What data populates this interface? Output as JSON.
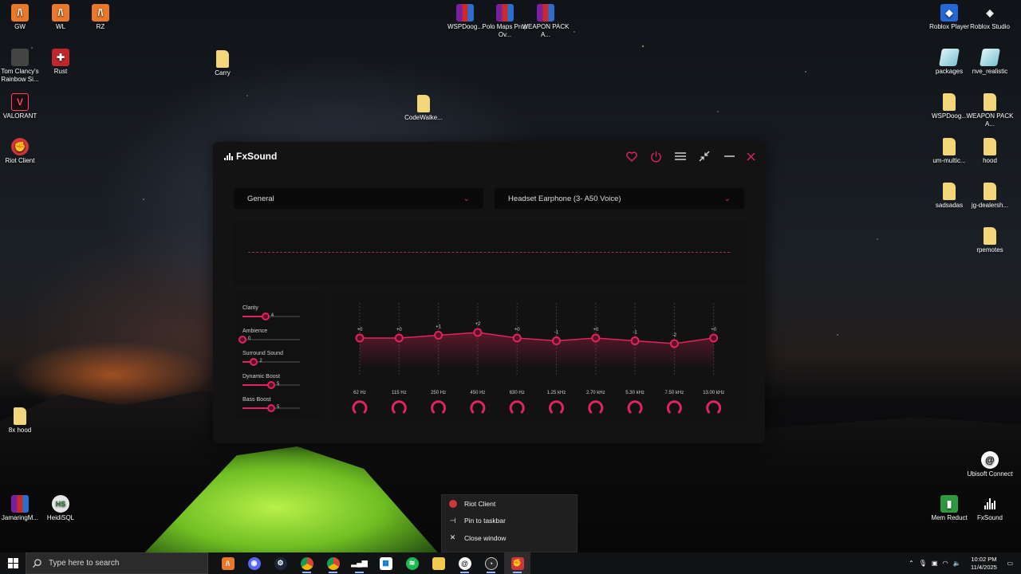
{
  "desktop": {
    "icons": [
      {
        "id": "gw",
        "label": "GW"
      },
      {
        "id": "wl",
        "label": "WL"
      },
      {
        "id": "rz",
        "label": "RZ"
      },
      {
        "id": "rainbow",
        "label": "Tom Clancy's Rainbow Si..."
      },
      {
        "id": "rust",
        "label": "Rust"
      },
      {
        "id": "carry",
        "label": "Carry"
      },
      {
        "id": "valorant",
        "label": "VALORANT"
      },
      {
        "id": "codewalke",
        "label": "CodeWalke..."
      },
      {
        "id": "riotclient",
        "label": "Riot Client"
      },
      {
        "id": "wspdoog1",
        "label": "WSPDoog..."
      },
      {
        "id": "polomaps",
        "label": "Polo Maps Prop Ov..."
      },
      {
        "id": "weaponpack1",
        "label": "WEAPON PACK A..."
      },
      {
        "id": "robloxplayer",
        "label": "Roblox Player"
      },
      {
        "id": "robloxstudio",
        "label": "Roblox Studio"
      },
      {
        "id": "packages",
        "label": "packages"
      },
      {
        "id": "nverealistic",
        "label": "nve_realistic"
      },
      {
        "id": "wspdoog2",
        "label": "WSPDoog..."
      },
      {
        "id": "weaponpack2",
        "label": "WEAPON PACK A..."
      },
      {
        "id": "ummultic",
        "label": "um-multic..."
      },
      {
        "id": "hood",
        "label": "hood"
      },
      {
        "id": "sadsadas",
        "label": "sadsadas"
      },
      {
        "id": "jgdealersh",
        "label": "jg-dealersh..."
      },
      {
        "id": "rpemotes",
        "label": "rpemotes"
      },
      {
        "id": "8xhood",
        "label": "8x hood"
      },
      {
        "id": "ubisoft",
        "label": "Ubisoft Connect"
      },
      {
        "id": "jamaringm",
        "label": "JamaringM..."
      },
      {
        "id": "heidisql",
        "label": "HeidiSQL"
      },
      {
        "id": "memreduct",
        "label": "Mem Reduct"
      },
      {
        "id": "fxsound",
        "label": "FxSound"
      }
    ]
  },
  "fxsound": {
    "title": "FxSound",
    "preset": "General",
    "output_device": "Headset Earphone (3- A50 Voice)",
    "effects": [
      {
        "name": "Clarity",
        "value": 4,
        "max": 10
      },
      {
        "name": "Ambience",
        "value": 0,
        "max": 10
      },
      {
        "name": "Surround Sound",
        "value": 2,
        "max": 10
      },
      {
        "name": "Dynamic Boost",
        "value": 5,
        "max": 10
      },
      {
        "name": "Bass Boost",
        "value": 5,
        "max": 10
      }
    ],
    "eq_bands": [
      {
        "freq": "62 Hz",
        "gain": 0,
        "label": "+0"
      },
      {
        "freq": "115 Hz",
        "gain": 0,
        "label": "+0"
      },
      {
        "freq": "250 Hz",
        "gain": 1,
        "label": "+1"
      },
      {
        "freq": "450 Hz",
        "gain": 2,
        "label": "+2"
      },
      {
        "freq": "630 Hz",
        "gain": 0,
        "label": "+0"
      },
      {
        "freq": "1.25 kHz",
        "gain": -1,
        "label": "-1"
      },
      {
        "freq": "2.70 kHz",
        "gain": 0,
        "label": "+0"
      },
      {
        "freq": "5.30 kHz",
        "gain": -1,
        "label": "-1"
      },
      {
        "freq": "7.50 kHz",
        "gain": -2,
        "label": "-2"
      },
      {
        "freq": "13.00 kHz",
        "gain": 0,
        "label": "+0"
      }
    ],
    "accent": "#e0245e"
  },
  "context_menu": {
    "items": [
      {
        "label": "Riot Client",
        "icon": "riot-client-icon"
      },
      {
        "label": "Pin to taskbar",
        "icon": "pin-icon"
      },
      {
        "label": "Close window",
        "icon": "close-icon"
      }
    ]
  },
  "taskbar": {
    "search_placeholder": "Type here to search",
    "time": "10:02 PM",
    "date": "11/4/2025"
  }
}
